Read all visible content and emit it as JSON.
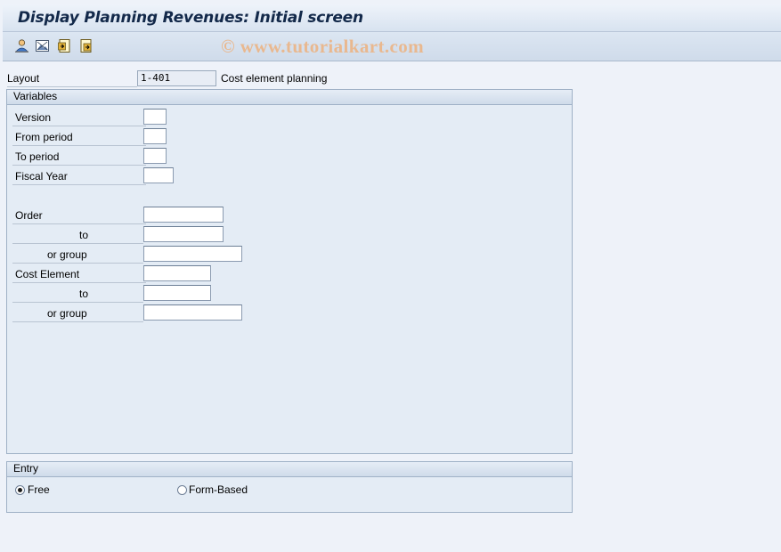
{
  "title": "Display Planning Revenues: Initial screen",
  "watermark": "© www.tutorialkart.com",
  "toolbar": {
    "icons": [
      "person-icon",
      "picture-icon",
      "get-variant-icon",
      "save-variant-icon"
    ]
  },
  "layout": {
    "label": "Layout",
    "value": "1-401",
    "description": "Cost element planning"
  },
  "variables": {
    "header": "Variables",
    "version": {
      "label": "Version",
      "value": ""
    },
    "from_period": {
      "label": "From period",
      "value": ""
    },
    "to_period": {
      "label": "To period",
      "value": ""
    },
    "fiscal_year": {
      "label": "Fiscal Year",
      "value": ""
    },
    "order": {
      "label": "Order",
      "value": ""
    },
    "order_to": {
      "label": "to",
      "value": ""
    },
    "order_group": {
      "label": "or group",
      "value": ""
    },
    "cost_element": {
      "label": "Cost Element",
      "value": ""
    },
    "cost_element_to": {
      "label": "to",
      "value": ""
    },
    "cost_element_group": {
      "label": "or group",
      "value": ""
    }
  },
  "entry": {
    "header": "Entry",
    "free": {
      "label": "Free",
      "selected": true
    },
    "form_based": {
      "label": "Form-Based",
      "selected": false
    }
  },
  "colors": {
    "title_text": "#13294a",
    "background": "#eef2f9",
    "group_border": "#9fb1c6",
    "watermark": "#e9b88f"
  }
}
